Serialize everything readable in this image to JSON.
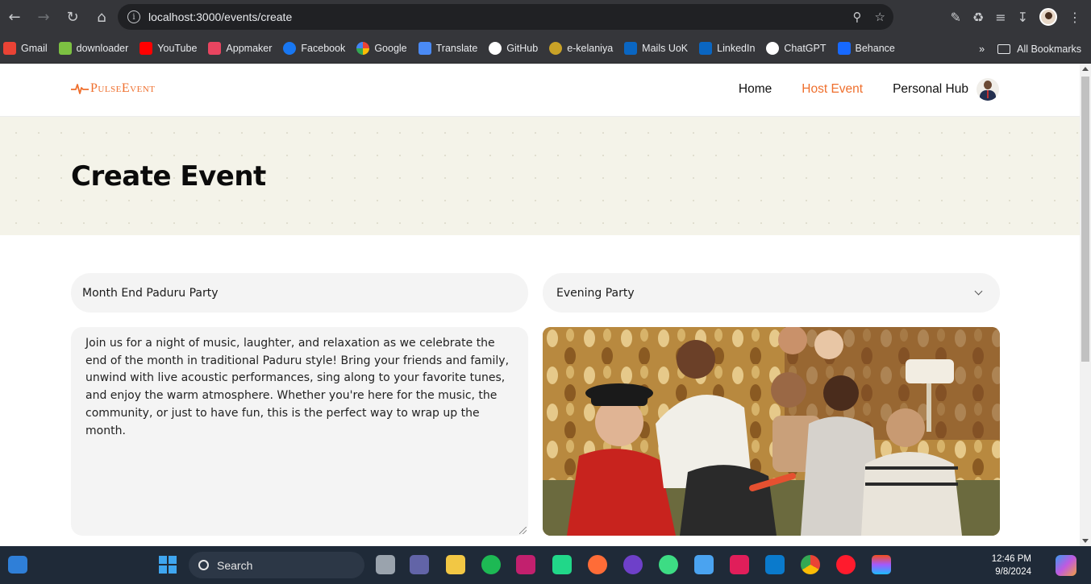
{
  "browser": {
    "url": "localhost:3000/events/create",
    "bookmarks": [
      {
        "label": "Gmail",
        "color": "#ea4335"
      },
      {
        "label": "downloader",
        "color": "#7cc142"
      },
      {
        "label": "YouTube",
        "color": "#ff0000"
      },
      {
        "label": "Appmaker",
        "color": "#e94560"
      },
      {
        "label": "Facebook",
        "color": "#1877f2"
      },
      {
        "label": "Google",
        "color": "#ffffff"
      },
      {
        "label": "Translate",
        "color": "#4a8af4"
      },
      {
        "label": "GitHub",
        "color": "#ffffff"
      },
      {
        "label": "e-kelaniya",
        "color": "#c9a227"
      },
      {
        "label": "Mails UoK",
        "color": "#0a66c2"
      },
      {
        "label": "LinkedIn",
        "color": "#0a66c2"
      },
      {
        "label": "ChatGPT",
        "color": "#ffffff"
      },
      {
        "label": "Behance",
        "color": "#1769ff"
      }
    ],
    "all_bookmarks": "All Bookmarks"
  },
  "site": {
    "logo": "PulseEvent",
    "brand_color": "#ef6f2d",
    "nav": {
      "home": "Home",
      "host_event": "Host Event",
      "personal_hub": "Personal Hub"
    }
  },
  "hero": {
    "title": "Create Event"
  },
  "form": {
    "event_title": "Month End Paduru Party",
    "event_type": "Evening Party",
    "description": "Join us for a night of music, laughter, and relaxation as we celebrate the end of the month in traditional Paduru style! Bring your friends and family, unwind with live acoustic performances, sing along to your favorite tunes, and enjoy the warm atmosphere. Whether you're here for the music, the community, or just to have fun, this is the perfect way to wrap up the month.",
    "image_alt": "event-cover-photo"
  },
  "taskbar": {
    "search_label": "Search",
    "time": "12:46 PM",
    "date": "9/8/2024"
  }
}
